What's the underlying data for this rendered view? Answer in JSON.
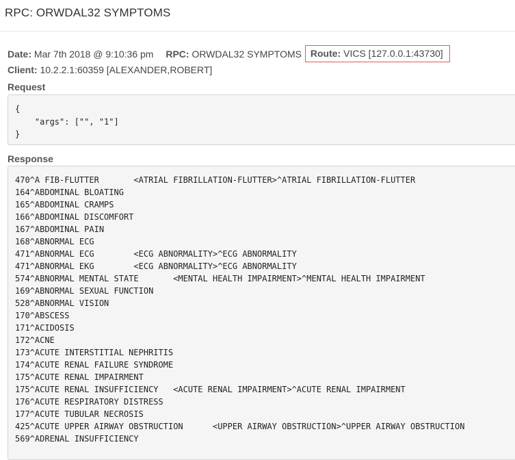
{
  "header": {
    "title": "RPC: ORWDAL32 SYMPTOMS"
  },
  "meta": {
    "date_label": "Date:",
    "date_value": "Mar 7th 2018 @ 9:10:36 pm",
    "rpc_label": "RPC:",
    "rpc_value": "ORWDAL32 SYMPTOMS",
    "route_label": "Route:",
    "route_value": "VICS [127.0.0.1:43730]",
    "client_label": "Client:",
    "client_value": "10.2.2.1:60359 [ALEXANDER,ROBERT]"
  },
  "colors": {
    "route_highlight": "#e25a4a"
  },
  "request": {
    "label": "Request",
    "lines": [
      "{",
      "    \"args\": [\"\", \"1\"]",
      "}"
    ]
  },
  "response": {
    "label": "Response",
    "lines": [
      "470^A FIB-FLUTTER       <ATRIAL FIBRILLATION-FLUTTER>^ATRIAL FIBRILLATION-FLUTTER",
      "164^ABDOMINAL BLOATING",
      "165^ABDOMINAL CRAMPS",
      "166^ABDOMINAL DISCOMFORT",
      "167^ABDOMINAL PAIN",
      "168^ABNORMAL ECG",
      "471^ABNORMAL ECG        <ECG ABNORMALITY>^ECG ABNORMALITY",
      "471^ABNORMAL EKG        <ECG ABNORMALITY>^ECG ABNORMALITY",
      "574^ABNORMAL MENTAL STATE       <MENTAL HEALTH IMPAIRMENT>^MENTAL HEALTH IMPAIRMENT",
      "169^ABNORMAL SEXUAL FUNCTION",
      "528^ABNORMAL VISION",
      "170^ABSCESS",
      "171^ACIDOSIS",
      "172^ACNE",
      "173^ACUTE INTERSTITIAL NEPHRITIS",
      "174^ACUTE RENAL FAILURE SYNDROME",
      "175^ACUTE RENAL IMPAIRMENT",
      "175^ACUTE RENAL INSUFFICIENCY   <ACUTE RENAL IMPAIRMENT>^ACUTE RENAL IMPAIRMENT",
      "176^ACUTE RESPIRATORY DISTRESS",
      "177^ACUTE TUBULAR NECROSIS",
      "425^ACUTE UPPER AIRWAY OBSTRUCTION      <UPPER AIRWAY OBSTRUCTION>^UPPER AIRWAY OBSTRUCTION",
      "569^ADRENAL INSUFFICIENCY"
    ]
  }
}
